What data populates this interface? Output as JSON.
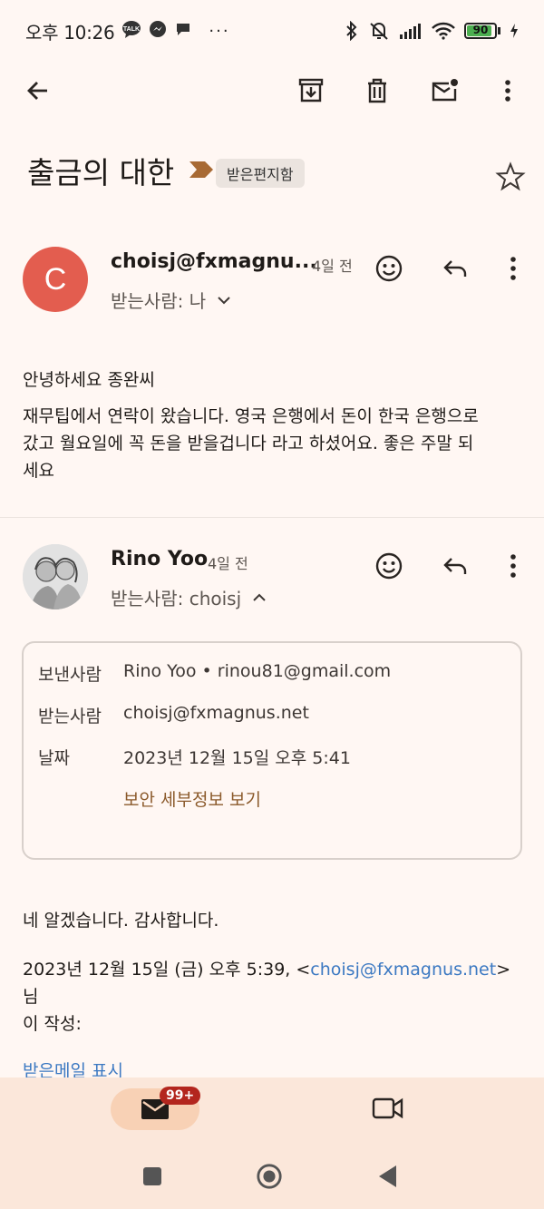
{
  "status_bar": {
    "time": "오후 10:26",
    "dots": "···",
    "battery_level": "90"
  },
  "email": {
    "subject": "출금의 대한",
    "label": "받은편지함"
  },
  "messages": [
    {
      "avatar_letter": "C",
      "sender": "choisj@fxmagnu...",
      "time": "4일 전",
      "recipient": "받는사람: 나",
      "body_lines": [
        "안녕하세요 종완씨",
        "재무팁에서 연락이 왔습니다. 영국 은행에서 돈이 한국 은행으로",
        "갔고 월요일에 꼭 돈을 받을겁니다 라고 하셨어요. 좋은 주말 되",
        "세요"
      ]
    },
    {
      "sender": "Rino Yoo",
      "time": "4일 전",
      "recipient": "받는사람: choisj",
      "details": {
        "from_label": "보낸사람",
        "from_value": "Rino Yoo • rinou81@gmail.com",
        "to_label": "받는사람",
        "to_value": "choisj@fxmagnus.net",
        "date_label": "날짜",
        "date_value": "2023년 12월 15일 오후 5:41",
        "security_link": "보안 세부정보 보기"
      },
      "body": "네 알겠습니다. 감사합니다.",
      "quote_prefix": "2023년 12월 15일 (금) 오후 5:39, <",
      "quote_email": "choisj@fxmagnus.net",
      "quote_suffix_1": ">님",
      "quote_suffix_2": "이 작성:",
      "show_quoted": "받은메일 표시"
    }
  ],
  "bottom_nav": {
    "mail_badge": "99+"
  }
}
